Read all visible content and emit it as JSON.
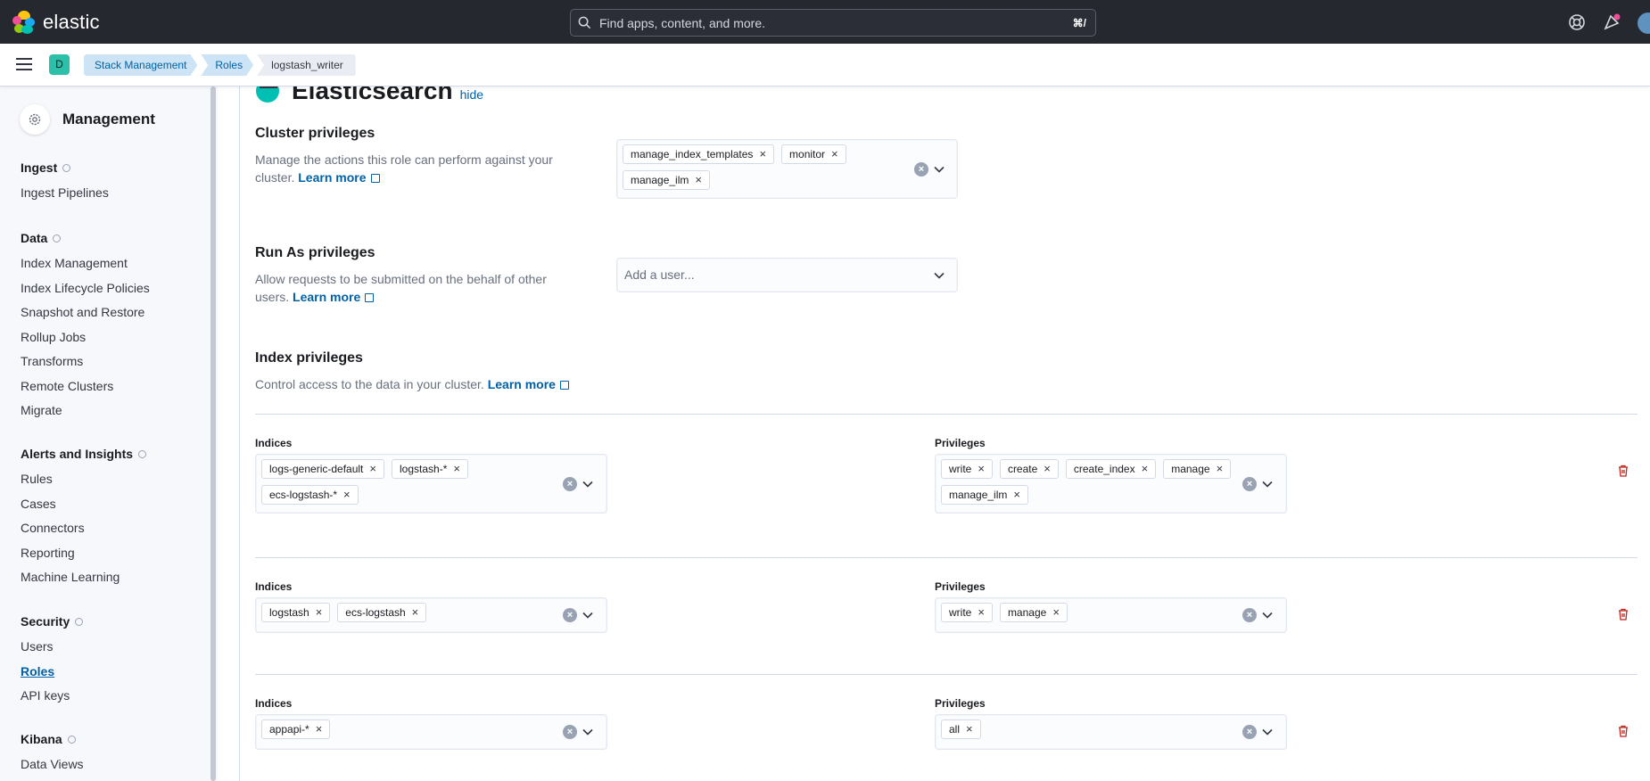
{
  "topbar": {
    "brand": "elastic",
    "search_placeholder": "Find apps, content, and more.",
    "search_shortcut": "⌘/",
    "colors": {
      "background": "#25282f",
      "accent": "#0077cc"
    }
  },
  "header": {
    "space_initial": "D",
    "breadcrumbs": [
      "Stack Management",
      "Roles",
      "logstash_writer"
    ]
  },
  "sidebar": {
    "title": "Management",
    "groups": [
      {
        "title": "Ingest",
        "items": [
          "Ingest Pipelines"
        ]
      },
      {
        "title": "Data",
        "items": [
          "Index Management",
          "Index Lifecycle Policies",
          "Snapshot and Restore",
          "Rollup Jobs",
          "Transforms",
          "Remote Clusters",
          "Migrate"
        ]
      },
      {
        "title": "Alerts and Insights",
        "items": [
          "Rules",
          "Cases",
          "Connectors",
          "Reporting",
          "Machine Learning"
        ]
      },
      {
        "title": "Security",
        "items": [
          "Users",
          "Roles",
          "API keys"
        ]
      },
      {
        "title": "Kibana",
        "items": [
          "Data Views"
        ]
      }
    ],
    "active_item": "Roles"
  },
  "main": {
    "section_title": "Elasticsearch",
    "hide_link": "hide",
    "cluster": {
      "title": "Cluster privileges",
      "description": "Manage the actions this role can perform against your cluster.",
      "learn_more": "Learn more",
      "tags": [
        "manage_index_templates",
        "monitor",
        "manage_ilm"
      ]
    },
    "run_as": {
      "title": "Run As privileges",
      "description": "Allow requests to be submitted on the behalf of other users.",
      "learn_more": "Learn more",
      "placeholder": "Add a user..."
    },
    "index_privileges": {
      "title": "Index privileges",
      "description": "Control access to the data in your cluster.",
      "learn_more": "Learn more",
      "indices_label": "Indices",
      "privileges_label": "Privileges",
      "rows": [
        {
          "indices": [
            "logs-generic-default",
            "logstash-*",
            "ecs-logstash-*"
          ],
          "privileges": [
            "write",
            "create",
            "create_index",
            "manage",
            "manage_ilm"
          ]
        },
        {
          "indices": [
            "logstash",
            "ecs-logstash"
          ],
          "privileges": [
            "write",
            "manage"
          ]
        },
        {
          "indices": [
            "appapi-*"
          ],
          "privileges": [
            "all"
          ]
        }
      ]
    }
  }
}
